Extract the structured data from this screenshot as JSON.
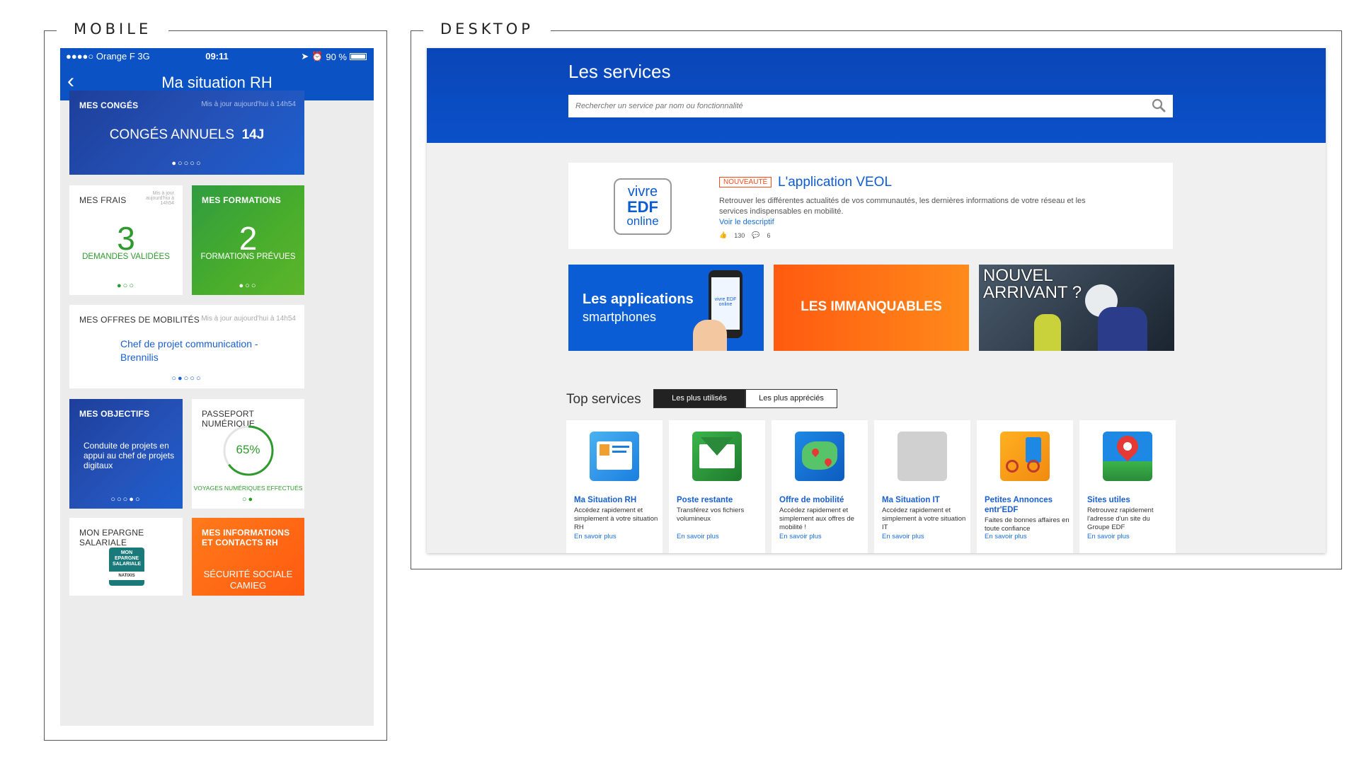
{
  "sections": {
    "mobile": "MOBILE",
    "desktop": "DESKTOP"
  },
  "mobile": {
    "status": {
      "carrier": "●●●●○ Orange F   3G",
      "time": "09:11",
      "battery": "90 %",
      "battery_level": 0.9
    },
    "nav": {
      "back": "‹",
      "title": "Ma situation RH"
    },
    "conges": {
      "title": "MES CONGÉS",
      "update": "Mis à jour aujourd'hui à 14h54",
      "label": "CONGÉS ANNUELS",
      "value": "14J",
      "dots": "●○○○○"
    },
    "frais": {
      "title": "MES FRAIS",
      "update": "Mis à jour aujourd'hui à 14h54",
      "number": "3",
      "label": "DEMANDES VALIDÉES",
      "dots": "●○○"
    },
    "formations": {
      "title": "MES FORMATIONS",
      "number": "2",
      "label": "FORMATIONS PRÉVUES",
      "dots": "●○○"
    },
    "mobilites": {
      "title": "MES OFFRES DE MOBILITÉS",
      "update": "Mis à jour aujourd'hui à 14h54",
      "line1": "Chef de projet communication -",
      "line2": "Brennilis",
      "dots": "○●○○○"
    },
    "objectifs": {
      "title": "MES OBJECTIFS",
      "text": "Conduite de projets en appui au chef de projets digitaux",
      "dots": "○○○●○"
    },
    "passeport": {
      "title": "PASSEPORT NUMÉRIQUE",
      "percent": "65%",
      "progress": 0.65,
      "label": "VOYAGES NUMÉRIQUES EFFECTUÉS",
      "dots": "○●"
    },
    "epargne": {
      "title": "MON EPARGNE SALARIALE",
      "logo_lines": [
        "MON",
        "EPARGNE",
        "SALARIALE"
      ],
      "logo_brand": "NATIXIS"
    },
    "infos": {
      "title": "MES INFORMATIONS ET CONTACTS RH",
      "line1": "SÉCURITÉ SOCIALE",
      "line2": "CAMIEG"
    }
  },
  "desktop": {
    "title": "Les services",
    "search_placeholder": "Rechercher un service par nom ou fonctionnalité",
    "veol": {
      "logo": [
        "vivre",
        "EDF",
        "online"
      ],
      "badge": "NOUVEAUTÉ",
      "title": "L'application VEOL",
      "desc": "Retrouver les différentes actualités de vos communautés, les dernières informations de votre réseau et les services indispensables en mobilité.",
      "link": "Voir le descriptif",
      "likes": "130",
      "comments": "6"
    },
    "tiles": {
      "apps_line1": "Les applications",
      "apps_line2": "smartphones",
      "phone_screen": "vivre EDF online",
      "immanquables": "LES IMMANQUABLES",
      "nouvel_line1": "NOUVEL",
      "nouvel_line2": "ARRIVANT ?"
    },
    "top": {
      "label": "Top services",
      "tab_used": "Les plus utilisés",
      "tab_liked": "Les plus appréciés"
    },
    "services": [
      {
        "name": "Ma Situation RH",
        "desc": "Accédez rapidement et simplement à votre situation RH",
        "more": "En savoir plus"
      },
      {
        "name": "Poste restante",
        "desc": "Transférez vos fichiers volumineux",
        "more": "En savoir plus"
      },
      {
        "name": "Offre de mobilité",
        "desc": "Accédez rapidement et simplement aux offres de mobilité !",
        "more": "En savoir plus"
      },
      {
        "name": "Ma Situation IT",
        "desc": "Accédez rapidement et simplement à votre situation IT",
        "more": "En savoir plus"
      },
      {
        "name": "Petites Annonces entr'EDF",
        "desc": "Faites de bonnes affaires en toute confiance",
        "more": "En savoir plus"
      },
      {
        "name": "Sites utiles",
        "desc": "Retrouvez rapidement l'adresse d'un site du Groupe EDF",
        "more": "En savoir plus"
      }
    ],
    "colors": {
      "header_blue": "#0b50c8",
      "link_blue": "#1a5fd0",
      "orange": "#ff5a10",
      "green": "#48ad2c"
    }
  }
}
